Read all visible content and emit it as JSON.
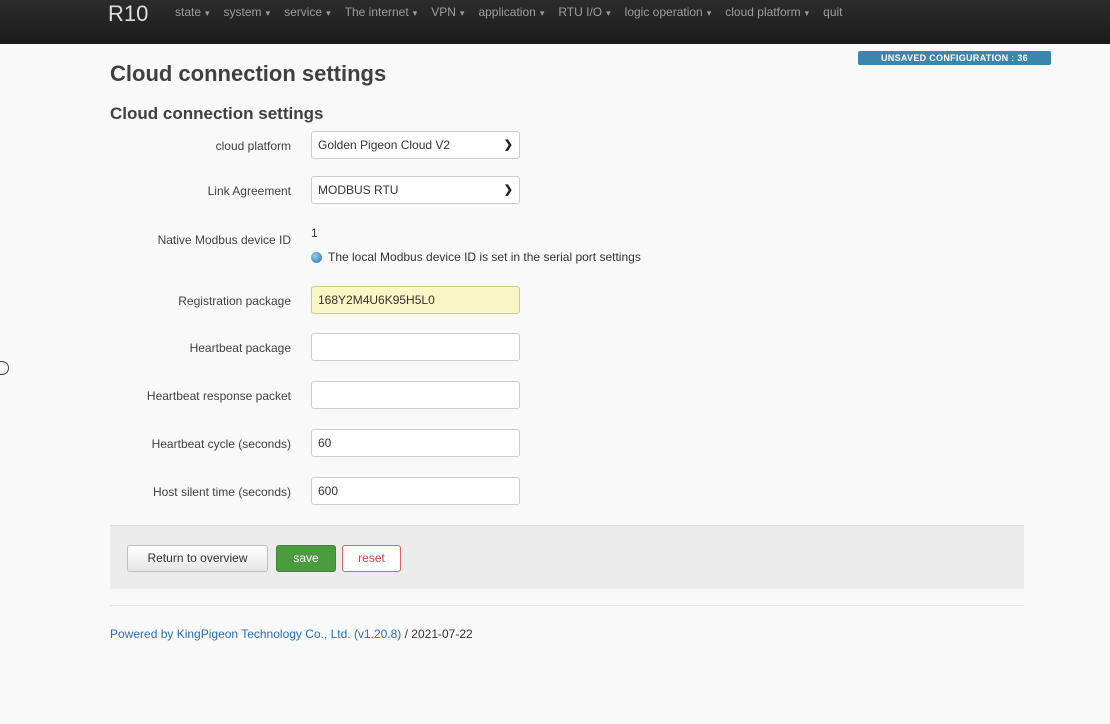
{
  "brand": "R10",
  "nav": [
    {
      "label": "state",
      "caret": "▾"
    },
    {
      "label": "system",
      "caret": "▾"
    },
    {
      "label": "service",
      "caret": "▾"
    },
    {
      "label": "The internet",
      "caret": "▾"
    },
    {
      "label": "VPN",
      "caret": "▾"
    },
    {
      "label": "application",
      "caret": "▾"
    },
    {
      "label": "RTU I/O",
      "caret": "▾"
    },
    {
      "label": "logic operation",
      "caret": "▾"
    },
    {
      "label": "cloud platform",
      "caret": "▾"
    },
    {
      "label": "quit",
      "caret": ""
    }
  ],
  "unsaved_badge": "UNSAVED CONFIGURATION : 36",
  "page_title": "Cloud connection settings",
  "section_title": "Cloud connection settings",
  "form": {
    "cloud_platform": {
      "label": "cloud platform",
      "value": "Golden Pigeon Cloud V2"
    },
    "link_agreement": {
      "label": "Link Agreement",
      "value": "MODBUS RTU"
    },
    "device_id": {
      "label": "Native Modbus device ID",
      "value": "1",
      "hint": "The local Modbus device ID is set in the serial port settings"
    },
    "registration": {
      "label": "Registration package",
      "value": "168Y2M4U6K95H5L0"
    },
    "heartbeat": {
      "label": "Heartbeat package",
      "value": ""
    },
    "heartbeat_response": {
      "label": "Heartbeat response packet",
      "value": ""
    },
    "heartbeat_cycle": {
      "label": "Heartbeat cycle (seconds)",
      "value": "60"
    },
    "host_silent": {
      "label": "Host silent time (seconds)",
      "value": "600"
    }
  },
  "actions": {
    "return_label": "Return to overview",
    "save_label": "save",
    "reset_label": "reset"
  },
  "footer": {
    "link_text": "Powered by KingPigeon Technology Co., Ltd. (v1.20.8)",
    "date_text": " / 2021-07-22"
  },
  "icons": {
    "chevron": "chevron-down-icon",
    "info": "info-icon"
  },
  "colors": {
    "navbar": "#1b1b1b",
    "badge": "#3a87ad",
    "save": "#4b9b3f",
    "reset": "#cc4444",
    "highlight": "#fbf7c4"
  }
}
